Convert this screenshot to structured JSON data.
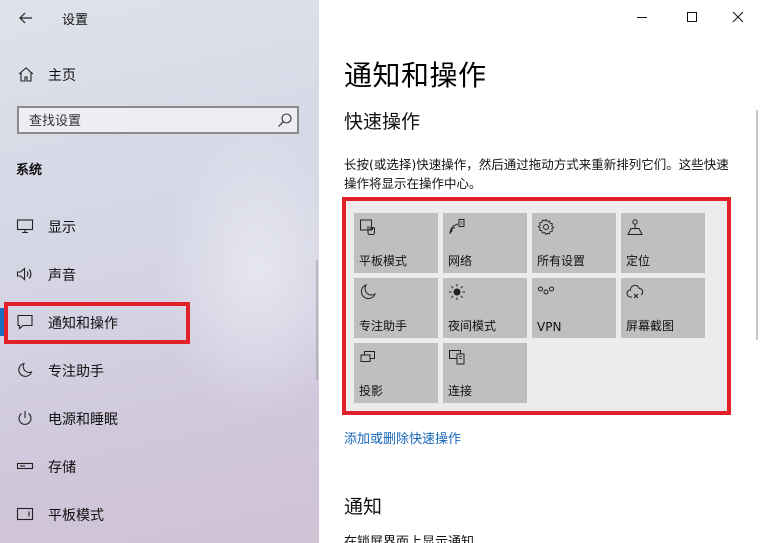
{
  "window": {
    "app_title": "设置",
    "controls": {
      "minimize": "minimize",
      "maximize": "maximize",
      "close": "close"
    }
  },
  "sidebar": {
    "home_label": "主页",
    "search_placeholder": "查找设置",
    "section_label": "系统",
    "items": [
      {
        "label": "显示",
        "icon": "monitor-icon"
      },
      {
        "label": "声音",
        "icon": "speaker-icon"
      },
      {
        "label": "通知和操作",
        "icon": "notification-icon",
        "active": true
      },
      {
        "label": "专注助手",
        "icon": "moon-icon"
      },
      {
        "label": "电源和睡眠",
        "icon": "power-icon"
      },
      {
        "label": "存储",
        "icon": "storage-icon"
      },
      {
        "label": "平板模式",
        "icon": "tablet-icon"
      }
    ]
  },
  "main": {
    "title": "通知和操作",
    "quick_actions": {
      "heading": "快速操作",
      "description": "长按(或选择)快速操作，然后通过拖动方式来重新排列它们。这些快速操作将显示在操作中心。",
      "tiles": [
        {
          "label": "平板模式",
          "icon": "tablet-mode-icon"
        },
        {
          "label": "网络",
          "icon": "network-icon"
        },
        {
          "label": "所有设置",
          "icon": "gear-icon"
        },
        {
          "label": "定位",
          "icon": "location-icon"
        },
        {
          "label": "专注助手",
          "icon": "moon-icon"
        },
        {
          "label": "夜间模式",
          "icon": "sun-icon"
        },
        {
          "label": "VPN",
          "icon": "vpn-icon"
        },
        {
          "label": "屏幕截图",
          "icon": "screenshot-icon"
        },
        {
          "label": "投影",
          "icon": "project-icon"
        },
        {
          "label": "连接",
          "icon": "connect-icon"
        }
      ],
      "edit_link": "添加或删除快速操作"
    },
    "notifications": {
      "heading": "通知",
      "partial_text": "在锁屏界面上显示通知"
    }
  },
  "colors": {
    "accent": "#1a6fc0",
    "link": "#1566b8",
    "highlight_border": "#e2202a",
    "tile_bg": "#bfbfbf"
  }
}
